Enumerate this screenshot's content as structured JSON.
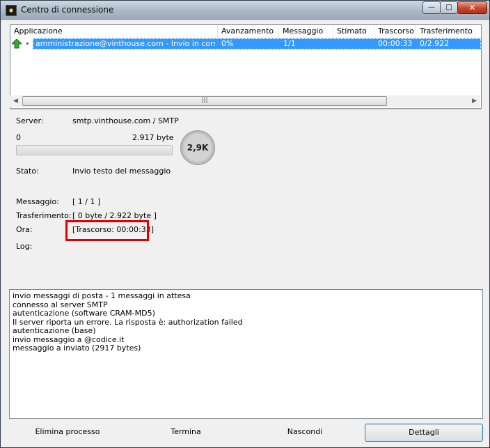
{
  "window": {
    "title": "Centro di connessione"
  },
  "title_buttons": {
    "minimize": "—",
    "maximize": "□",
    "close": "✕"
  },
  "list": {
    "columns": [
      "Applicazione",
      "Avanzamento",
      "Messaggio",
      "Stimato",
      "Trascorso",
      "Trasferimento"
    ],
    "row": {
      "icon": "green-up-arrow-icon",
      "applicazione": "amministrazione@vinthouse.com - Invio in corso ...",
      "avanzamento": "0%",
      "messaggio": "1/1",
      "stimato": "",
      "trascorso": "00:00:33",
      "trasferimento": "0/2.922"
    },
    "scroll_left": "◀",
    "scroll_right": "▶",
    "scroll_grip": "|||"
  },
  "details": {
    "server_label": "Server:",
    "server_value": "smtp.vinthouse.com / SMTP",
    "progress_min": "0",
    "progress_max": "2.917 byte",
    "progress_fraction": 0,
    "size_badge": "2,9K",
    "stato_label": "Stato:",
    "stato_value": "Invio testo del messaggio",
    "messaggio_label": "Messaggio:",
    "messaggio_value": "[ 1 / 1 ]",
    "trasferimento_label": "Trasferimento:",
    "trasferimento_value": "[ 0 byte / 2.922 byte ]",
    "ora_label": "Ora:",
    "ora_value": "[Trascorso: 00:00:33]",
    "log_label": "Log:"
  },
  "log_lines": [
    "invio messaggi di posta - 1 messaggi in attesa",
    "connesso al server SMTP",
    "autenticazione (software CRAM-MD5)",
    "Il server riporta un errore. La risposta è: authorization failed",
    "autenticazione (base)",
    "invio messaggio a                    @codice.it",
    "messaggio a                                        inviato (2917 bytes)"
  ],
  "buttons": {
    "elimina": "Elimina processo",
    "termina": "Termina",
    "nascondi": "Nascondi",
    "dettagli": "Dettagli"
  },
  "colors": {
    "selection": "#3399ff",
    "highlight_box": "#e00000"
  }
}
